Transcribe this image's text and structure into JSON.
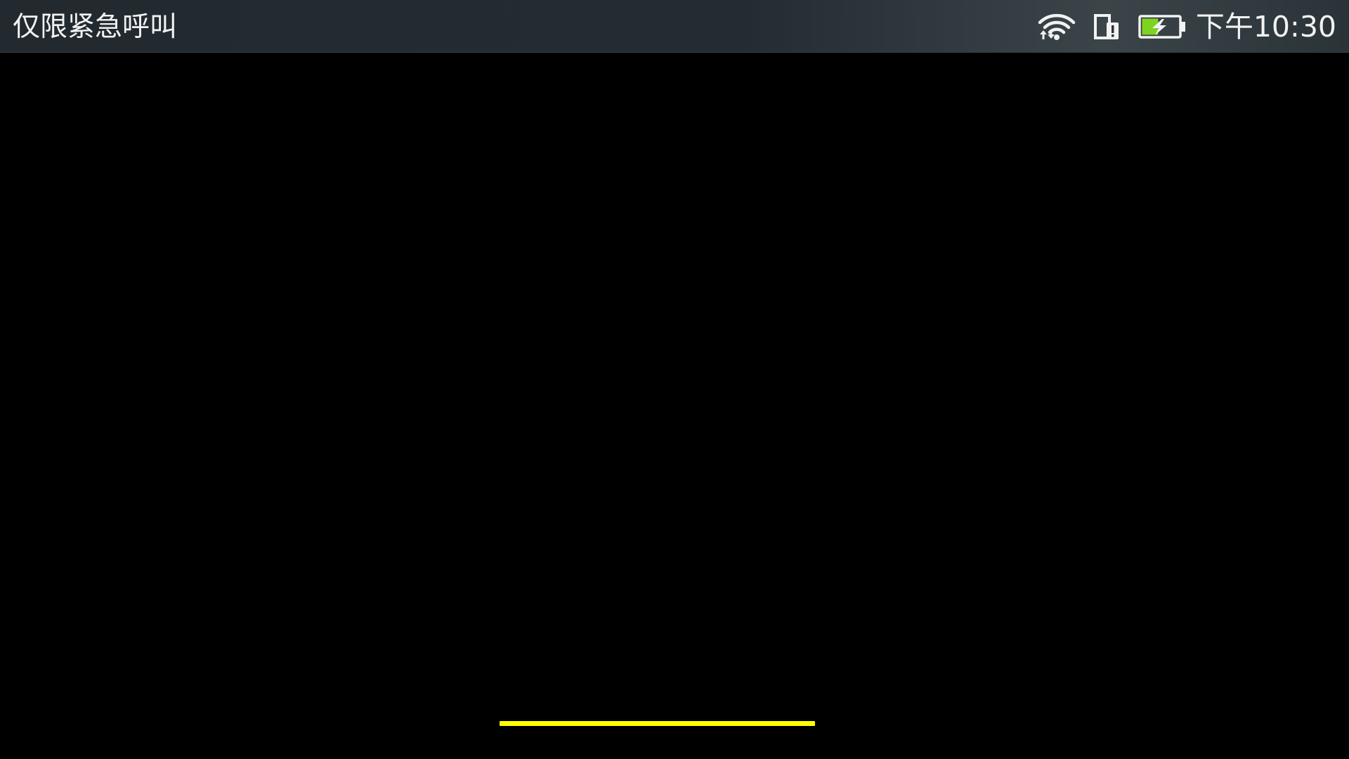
{
  "status_bar": {
    "carrier_text": "仅限紧急呼叫",
    "time": "下午10:30",
    "icons": [
      "wifi-icon",
      "device-alert-icon",
      "battery-charging-icon"
    ],
    "battery_level": 0.45,
    "battery_color": "#7ed321"
  },
  "loading_bar": {
    "progress": 1.0,
    "color": "#ffff00"
  }
}
